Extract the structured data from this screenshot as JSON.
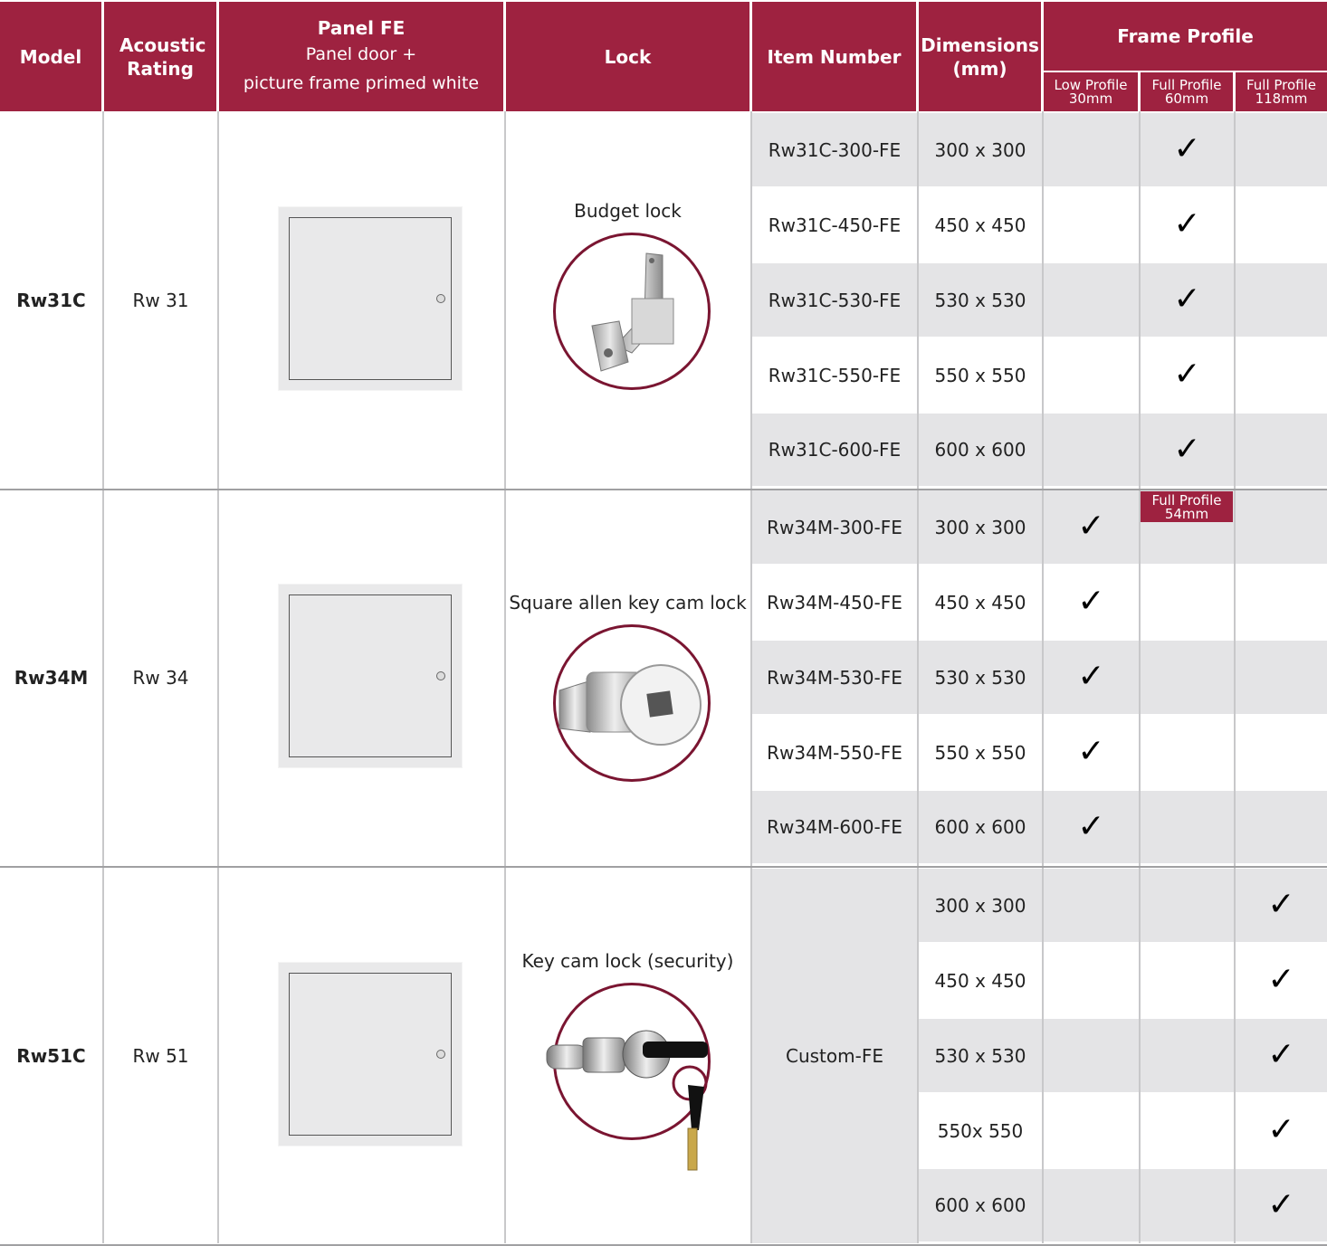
{
  "header": {
    "model": "Model",
    "acoustic": "Acoustic Rating",
    "panel_title": "Panel FE",
    "panel_sub1": "Panel door +",
    "panel_sub2": "picture frame primed white",
    "lock": "Lock",
    "item_number": "Item Number",
    "dimensions_1": "Dimensions",
    "dimensions_2": "(mm)",
    "frame_profile": "Frame Profile",
    "low_profile_1": "Low Profile",
    "low_profile_2": "30mm",
    "full60_1": "Full Profile",
    "full60_2": "60mm",
    "full118_1": "Full Profile",
    "full118_2": "118mm"
  },
  "subheader_full54_1": "Full Profile",
  "subheader_full54_2": "54mm",
  "check_glyph": "✓",
  "colors": {
    "brand": "#9e2240",
    "ring": "#7a1531",
    "stripe": "#e4e4e6"
  },
  "groups": [
    {
      "model": "Rw31C",
      "rating": "Rw 31",
      "lock": "Budget lock",
      "lock_icon": "budget-lock-icon",
      "rows": [
        {
          "item": "Rw31C-300-FE",
          "dim": "300 x 300",
          "low": false,
          "full60": true,
          "full118": false
        },
        {
          "item": "Rw31C-450-FE",
          "dim": "450 x 450",
          "low": false,
          "full60": true,
          "full118": false
        },
        {
          "item": "Rw31C-530-FE",
          "dim": "530 x 530",
          "low": false,
          "full60": true,
          "full118": false
        },
        {
          "item": "Rw31C-550-FE",
          "dim": "550 x 550",
          "low": false,
          "full60": true,
          "full118": false
        },
        {
          "item": "Rw31C-600-FE",
          "dim": "600 x 600",
          "low": false,
          "full60": true,
          "full118": false
        }
      ]
    },
    {
      "model": "Rw34M",
      "rating": "Rw 34",
      "lock": "Square allen key cam lock",
      "lock_icon": "cam-lock-icon",
      "rows": [
        {
          "item": "Rw34M-300-FE",
          "dim": "300 x 300",
          "low": true,
          "full60": false,
          "full118": false
        },
        {
          "item": "Rw34M-450-FE",
          "dim": "450 x 450",
          "low": true,
          "full60": false,
          "full118": false
        },
        {
          "item": "Rw34M-530-FE",
          "dim": "530 x 530",
          "low": true,
          "full60": false,
          "full118": false
        },
        {
          "item": "Rw34M-550-FE",
          "dim": "550 x 550",
          "low": true,
          "full60": false,
          "full118": false
        },
        {
          "item": "Rw34M-600-FE",
          "dim": "600 x 600",
          "low": true,
          "full60": false,
          "full118": false
        }
      ]
    },
    {
      "model": "Rw51C",
      "rating": "Rw 51",
      "lock": "Key cam lock (security)",
      "lock_icon": "key-cam-lock-icon",
      "item_merged": "Custom-FE",
      "rows": [
        {
          "dim": "300 x 300",
          "low": false,
          "full60": false,
          "full118": true
        },
        {
          "dim": "450 x 450",
          "low": false,
          "full60": false,
          "full118": true
        },
        {
          "dim": "530 x 530",
          "low": false,
          "full60": false,
          "full118": true
        },
        {
          "dim": "550x 550",
          "low": false,
          "full60": false,
          "full118": true
        },
        {
          "dim": "600 x 600",
          "low": false,
          "full60": false,
          "full118": true
        }
      ]
    }
  ]
}
